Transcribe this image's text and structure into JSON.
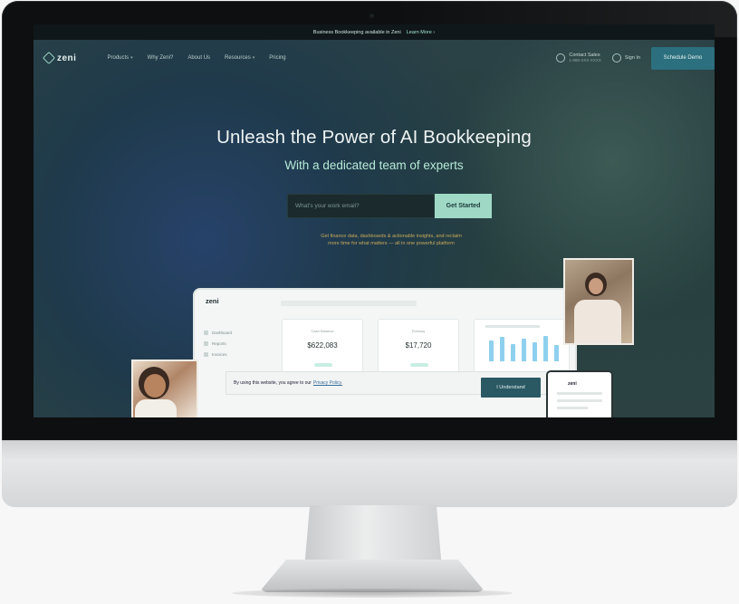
{
  "announcement": {
    "text": "Business Bookkeeping available in Zeni",
    "link": "Learn More ›"
  },
  "nav": {
    "logo": "zeni",
    "links": [
      {
        "label": "Products",
        "caret": true
      },
      {
        "label": "Why Zeni?",
        "caret": false
      },
      {
        "label": "About Us",
        "caret": false
      },
      {
        "label": "Resources",
        "caret": true
      },
      {
        "label": "Pricing",
        "caret": false
      }
    ],
    "contact_label": "Contact Sales",
    "contact_phone": "1-888-XXX-XXXX",
    "signin": "Sign In",
    "cta": "Schedule Demo"
  },
  "hero": {
    "title": "Unleash the Power of AI Bookkeeping",
    "subtitle": "With a dedicated team of experts",
    "email_placeholder": "What's your work email?",
    "button": "Get Started",
    "fineprint_1": "Get finance data, dashboards & actionable insights, and reclaim",
    "fineprint_2": "more time for what matters — all in one powerful platform"
  },
  "dashboard": {
    "logo": "zeni",
    "sidebar": [
      "Dashboard",
      "Reports",
      "Invoices"
    ],
    "cards": [
      {
        "label": "Cash Balance",
        "value": "$622,083"
      },
      {
        "label": "Runway",
        "value": "$17,720"
      }
    ],
    "chart_values": [
      60,
      70,
      50,
      65,
      55,
      72,
      45
    ]
  },
  "cookie": {
    "text": "By using this website, you agree to our",
    "link": "Privacy Policy.",
    "button": "I Understand"
  },
  "phone": {
    "logo": "zeni"
  }
}
